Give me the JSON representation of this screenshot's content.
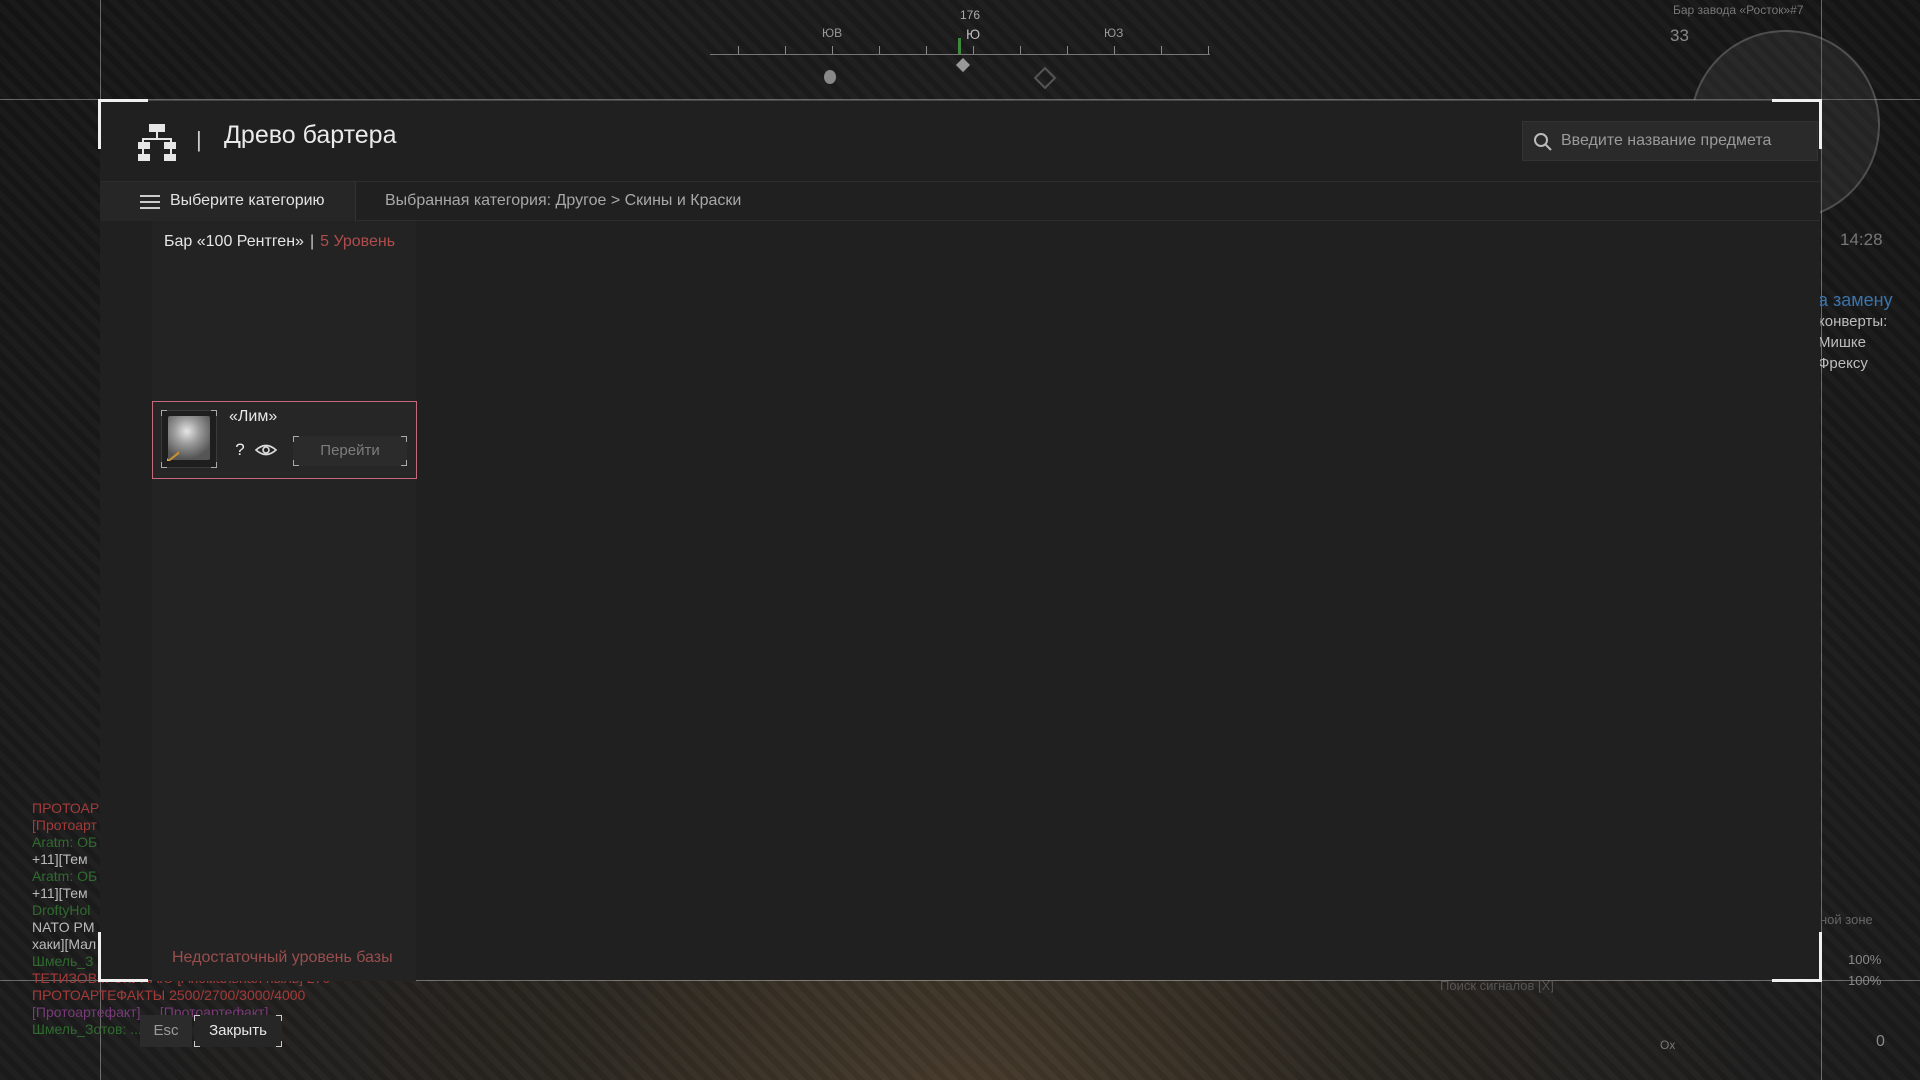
{
  "hud": {
    "compass": {
      "heading": "176",
      "dirs": [
        "ЮВ",
        "Ю",
        "ЮЗ"
      ]
    },
    "location": "Бар завода «Росток»#7",
    "counter": "33",
    "clock": "14:28",
    "quest": {
      "title": "а замену",
      "lines": [
        "конверты:",
        "Мишке",
        "Фрексу"
      ]
    },
    "zone": "ной зоне",
    "signals": "Поиск сигналов [X]",
    "bars": [
      "100%",
      "100%"
    ],
    "counter_bottom": "0",
    "ox_label": "Ox",
    "chat": [
      {
        "text": "ПРОТОАР",
        "cls": "c-red"
      },
      {
        "text": "[Протоарт",
        "cls": "c-red"
      },
      {
        "text": "Aratm: ОБ",
        "cls": "c-green"
      },
      {
        "text": "+11][Тем",
        "cls": "c-white"
      },
      {
        "text": "Aratm: ОБ",
        "cls": "c-green"
      },
      {
        "text": "+11][Тем",
        "cls": "c-white"
      },
      {
        "text": "DroftyHol",
        "cls": "c-green"
      },
      {
        "text": "NATO PM",
        "cls": "c-white"
      },
      {
        "text": "хаки][Мал",
        "cls": "c-white"
      },
      {
        "text": "Шмель_З",
        "cls": "c-green"
      },
      {
        "text": "ТЕТИЗОВ... СКУПАЮ [Аномальная пыль] 270",
        "cls": "c-red"
      },
      {
        "text": "ПРОТОАРТЕФАКТЫ 2500/2700/3000/4000",
        "cls": "c-red"
      },
      {
        "text": "[Протоартефакт] ... [Протоартефакт].",
        "cls": "c-purple"
      },
      {
        "text": "Шмель_Зотов: ... 10 53К",
        "cls": "c-green"
      }
    ]
  },
  "window": {
    "title": "Древо бартера",
    "search_placeholder": "Введите название предмета",
    "category_button": "Выберите категорию",
    "breadcrumb": "Выбранная категория: Другое > Скины и Краски"
  },
  "column": {
    "vendor": "Бар «100 Рентген»",
    "separator": "|",
    "level": "5 Уровень",
    "item": {
      "name": "«Лим»",
      "help": "?",
      "go_label": "Перейти"
    },
    "warning": "Недостаточный уровень базы"
  },
  "footer": {
    "esc_key": "Esc",
    "close_label": "Закрыть"
  }
}
